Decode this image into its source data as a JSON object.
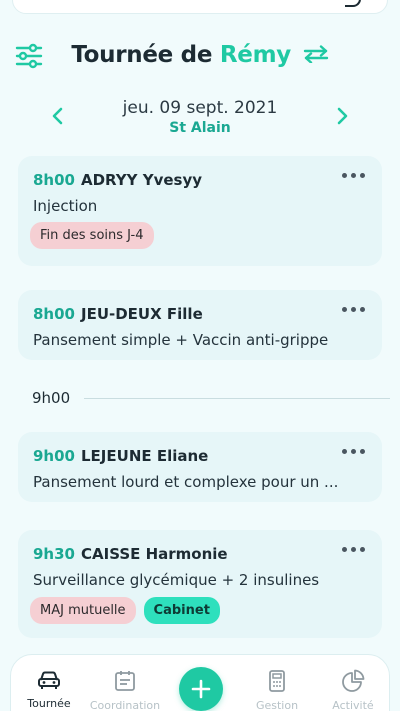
{
  "header": {
    "title_prefix": "Tournée de ",
    "title_name": "Rémy"
  },
  "date": {
    "label": "jeu. 09 sept. 2021",
    "saint": "St Alain"
  },
  "appointments": [
    {
      "time": "8h00",
      "patient": "ADRYY Yvesyy",
      "act": "Injection",
      "badges": [
        "Fin des soins J-4"
      ]
    },
    {
      "time": "8h00",
      "patient": "JEU-DEUX Fille",
      "act": "Pansement simple + Vaccin anti-grippe",
      "badges": []
    },
    {
      "time": "9h00",
      "patient": "LEJEUNE Eliane",
      "act": "Pansement lourd et complexe pour un ...",
      "badges": []
    },
    {
      "time": "9h30",
      "patient": "CAISSE Harmonie",
      "act": "Surveillance glycémique + 2 insulines",
      "badges": [
        "MAJ mutuelle",
        "Cabinet"
      ]
    }
  ],
  "separator": {
    "hour": "9h00"
  },
  "nav": {
    "tournee": "Tournée",
    "coordination": "Coordination",
    "gestion": "Gestion",
    "activite": "Activité"
  },
  "colors": {
    "accent": "#1fc9a3",
    "card_bg": "#e6f6f8",
    "badge_pink": "#f5cfd3",
    "badge_teal": "#2ee0bd"
  }
}
